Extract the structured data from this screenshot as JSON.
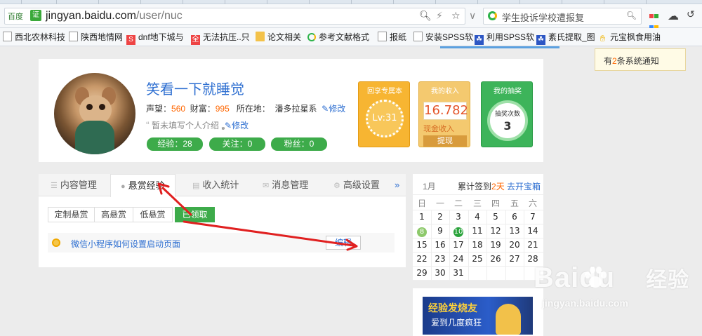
{
  "browser": {
    "site_badge": "百度",
    "cert_label": "证",
    "url_host": "jingyan.baidu.com",
    "url_path": "/user/nuc",
    "search_placeholder": "学生投诉学校遭报复"
  },
  "bookmarks": [
    {
      "label": "西北农林科技",
      "icon": "doc-icon"
    },
    {
      "label": "陕西地情网",
      "icon": "doc-icon"
    },
    {
      "label": "dnf地下城与",
      "icon": "red-s-icon",
      "glyph": "S"
    },
    {
      "label": "无法抗压..只",
      "icon": "red-logo-icon",
      "glyph": "全"
    },
    {
      "label": "论文相关",
      "icon": "folder-icon"
    },
    {
      "label": "参考文献格式",
      "icon": "360-icon"
    },
    {
      "label": "报纸",
      "icon": "doc-icon"
    },
    {
      "label": "安装SPSS软",
      "icon": "doc-icon"
    },
    {
      "label": "利用SPSS软",
      "icon": "paw-icon"
    },
    {
      "label": "紊氏提取_图",
      "icon": "paw-icon"
    },
    {
      "label": "元宝枫食用油",
      "icon": "hand-icon"
    }
  ],
  "notice": {
    "prefix": "有",
    "count": "2",
    "suffix": "条系统通知"
  },
  "profile": {
    "name": "笑看一下就睡觉",
    "rep_label": "声望：",
    "rep_value": "560",
    "wealth_label": "财富：",
    "wealth_value": "995",
    "location_label": "所在地：",
    "location_value": "潘多拉星系",
    "edit_label": "修改",
    "intro_text": "暂未填写个人介绍",
    "intro_edit": "修改",
    "pills": [
      "经验：28",
      "关注：0",
      "粉丝：0"
    ]
  },
  "cards": {
    "vip": {
      "title": "回享专属本",
      "level": "Lv:31"
    },
    "income": {
      "title": "我的收入",
      "value": "16.782",
      "label": "现金收入",
      "button": "提现"
    },
    "lottery": {
      "title": "我的抽奖",
      "sub": "抽奖次数",
      "value": "3"
    }
  },
  "tabs": [
    "内容管理",
    "悬赏经验",
    "收入统计",
    "消息管理",
    "高级设置"
  ],
  "more": "»",
  "subtabs": [
    "定制悬赏",
    "高悬赏",
    "低悬赏",
    "已领取"
  ],
  "task": {
    "title": "微信小程序如何设置启动页面",
    "action": "编辑"
  },
  "calendar": {
    "month": "1月",
    "signin_prefix": "累计签到",
    "signin_days": "2天",
    "go_label": "去开宝箱",
    "weekdays": [
      "日",
      "一",
      "二",
      "三",
      "四",
      "五",
      "六"
    ],
    "days": [
      [
        "1",
        "2",
        "3",
        "4",
        "5",
        "6",
        "7"
      ],
      [
        "8",
        "9",
        "10",
        "11",
        "12",
        "13",
        "14"
      ],
      [
        "15",
        "16",
        "17",
        "18",
        "19",
        "20",
        "21"
      ],
      [
        "22",
        "23",
        "24",
        "25",
        "26",
        "27",
        "28"
      ],
      [
        "29",
        "30",
        "31",
        "",
        "",
        "",
        ""
      ]
    ]
  },
  "banner": {
    "line1": "经验发烧友",
    "line2": "爱到几度疯狂"
  },
  "watermark": {
    "brand": "Baidu",
    "suffix": "经验",
    "url": "jingyan.baidu.com"
  },
  "colors": {
    "accent_green": "#3dab4a",
    "link_blue": "#2e6fd1",
    "highlight_orange": "#ff6600",
    "annotation_red": "#e02020"
  }
}
